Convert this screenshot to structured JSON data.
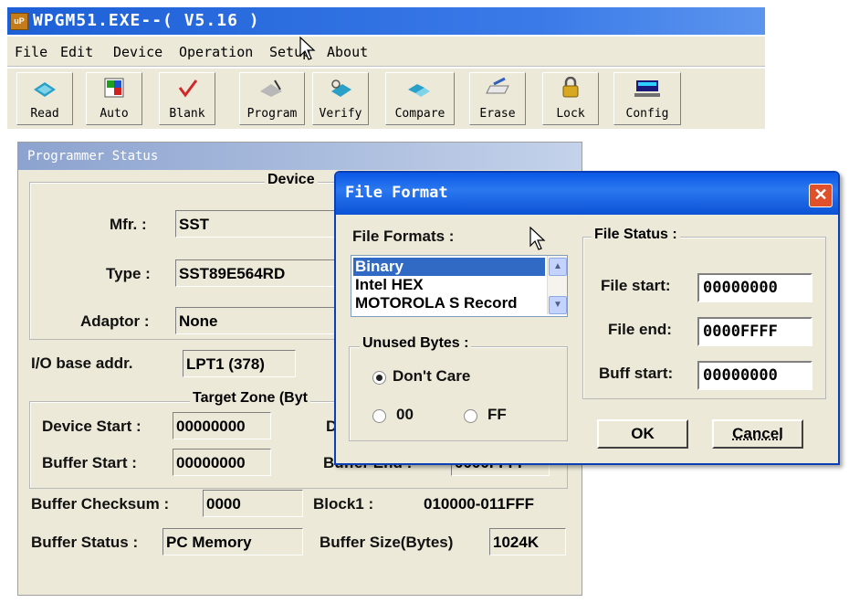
{
  "window": {
    "title": "WPGM51.EXE--( V5.16 )",
    "app_icon_text": "uP"
  },
  "menu": [
    "File",
    "Edit",
    "Device",
    "Operation",
    "Setup",
    "About"
  ],
  "toolbar": {
    "buttons": [
      {
        "label": "Read",
        "icon": "read-chip-icon"
      },
      {
        "label": "Auto",
        "icon": "auto-icon"
      },
      {
        "label": "Blank",
        "icon": "blank-check-icon"
      },
      {
        "label": "Program",
        "icon": "program-icon"
      },
      {
        "label": "Verify",
        "icon": "verify-icon"
      },
      {
        "label": "Compare",
        "icon": "compare-icon"
      },
      {
        "label": "Erase",
        "icon": "erase-icon"
      },
      {
        "label": "Lock",
        "icon": "lock-icon"
      },
      {
        "label": "Config",
        "icon": "config-icon"
      }
    ]
  },
  "status": {
    "header": "Programmer Status",
    "device_group": "Device",
    "mfr_label": "Mfr. :",
    "mfr_value": "SST",
    "type_label": "Type :",
    "type_value": "SST89E564RD",
    "adaptor_label": "Adaptor :",
    "adaptor_value": "None",
    "io_label": "I/O base addr.",
    "io_value": "LPT1 (378)",
    "target_group": "Target Zone (Byt",
    "device_start_label": "Device Start :",
    "device_start_value": "00000000",
    "device_end_label_partial": "D",
    "buffer_start_label": "Buffer Start :",
    "buffer_start_value": "00000000",
    "buffer_end_label_partial": "Buffer End :",
    "buffer_end_value_partial": "0000FFFF",
    "checksum_label": "Buffer Checksum :",
    "checksum_value": "0000",
    "block_label": "Block1 :",
    "block_value": "010000-011FFF",
    "buffer_status_label": "Buffer Status :",
    "buffer_status_value": "PC Memory",
    "buffer_size_label": "Buffer Size(Bytes)",
    "buffer_size_value": "1024K"
  },
  "dialog": {
    "title": "File Format",
    "formats_label": "File Formats :",
    "formats": [
      "Binary",
      "Intel HEX",
      "MOTOROLA S Record"
    ],
    "selected_format": "Binary",
    "unused_group": "Unused Bytes :",
    "unused_options": [
      "Don't Care",
      "00",
      "FF"
    ],
    "unused_selected": "Don't Care",
    "file_status_group": "File Status :",
    "file_start_label": "File start:",
    "file_start_value": "00000000",
    "file_end_label": "File end:",
    "file_end_value": "0000FFFF",
    "buff_start_label": "Buff start:",
    "buff_start_value": "00000000",
    "ok_label": "OK",
    "cancel_label": "Cancel"
  },
  "colors": {
    "title_blue": "#1d5fd6",
    "selection": "#316ac5",
    "close_red": "#e0502a",
    "face": "#ece9d8"
  }
}
